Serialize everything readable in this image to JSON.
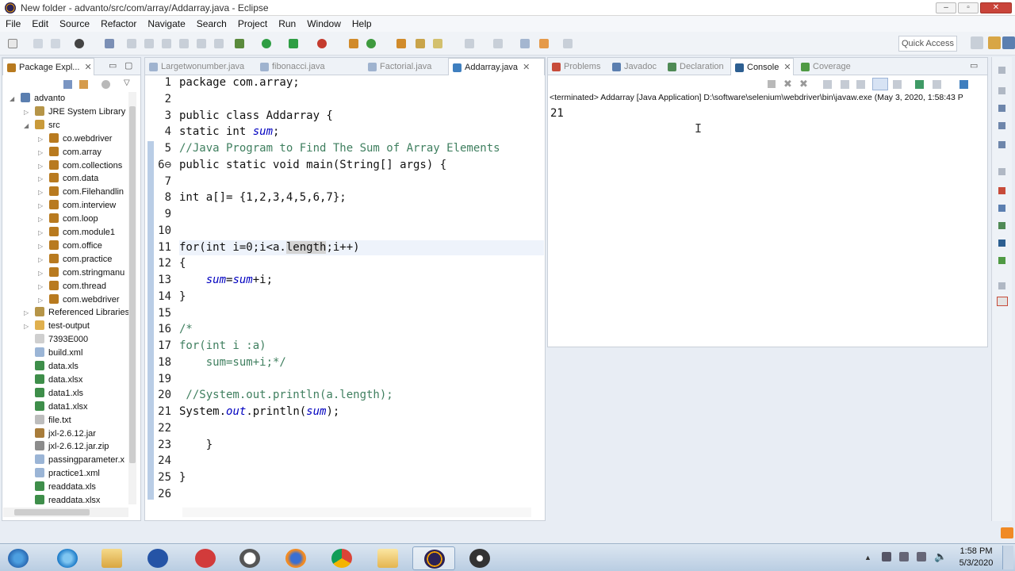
{
  "window": {
    "title": "New folder - advanto/src/com/array/Addarray.java - Eclipse"
  },
  "menu": [
    "File",
    "Edit",
    "Source",
    "Refactor",
    "Navigate",
    "Search",
    "Project",
    "Run",
    "Window",
    "Help"
  ],
  "quick_access": "Quick Access",
  "package_explorer": {
    "tab_label": "Package Expl...",
    "tree": [
      {
        "label": "advanto",
        "indent": 0,
        "icon": "project-icon",
        "expanded": true
      },
      {
        "label": "JRE System Library [",
        "indent": 1,
        "icon": "library-icon"
      },
      {
        "label": "src",
        "indent": 1,
        "icon": "source-folder-icon",
        "expanded": true
      },
      {
        "label": "co.webdriver",
        "indent": 2,
        "icon": "package-icon"
      },
      {
        "label": "com.array",
        "indent": 2,
        "icon": "package-icon"
      },
      {
        "label": "com.collections",
        "indent": 2,
        "icon": "package-icon"
      },
      {
        "label": "com.data",
        "indent": 2,
        "icon": "package-icon"
      },
      {
        "label": "com.Filehandlin",
        "indent": 2,
        "icon": "package-icon"
      },
      {
        "label": "com.interview",
        "indent": 2,
        "icon": "package-icon"
      },
      {
        "label": "com.loop",
        "indent": 2,
        "icon": "package-icon"
      },
      {
        "label": "com.module1",
        "indent": 2,
        "icon": "package-icon"
      },
      {
        "label": "com.office",
        "indent": 2,
        "icon": "package-icon"
      },
      {
        "label": "com.practice",
        "indent": 2,
        "icon": "package-icon"
      },
      {
        "label": "com.stringmanu",
        "indent": 2,
        "icon": "package-icon"
      },
      {
        "label": "com.thread",
        "indent": 2,
        "icon": "package-icon"
      },
      {
        "label": "com.webdriver",
        "indent": 2,
        "icon": "package-icon"
      },
      {
        "label": "Referenced Libraries",
        "indent": 1,
        "icon": "library-icon"
      },
      {
        "label": "test-output",
        "indent": 1,
        "icon": "folder-icon"
      },
      {
        "label": "7393E000",
        "indent": 1,
        "icon": "file-icon"
      },
      {
        "label": "build.xml",
        "indent": 1,
        "icon": "xml-file-icon"
      },
      {
        "label": "data.xls",
        "indent": 1,
        "icon": "excel-file-icon"
      },
      {
        "label": "data.xlsx",
        "indent": 1,
        "icon": "excel-file-icon"
      },
      {
        "label": "data1.xls",
        "indent": 1,
        "icon": "excel-file-icon"
      },
      {
        "label": "data1.xlsx",
        "indent": 1,
        "icon": "excel-file-icon"
      },
      {
        "label": "file.txt",
        "indent": 1,
        "icon": "text-file-icon"
      },
      {
        "label": "jxl-2.6.12.jar",
        "indent": 1,
        "icon": "jar-file-icon"
      },
      {
        "label": "jxl-2.6.12.jar.zip",
        "indent": 1,
        "icon": "zip-file-icon"
      },
      {
        "label": "passingparameter.x",
        "indent": 1,
        "icon": "xml-file-icon"
      },
      {
        "label": "practice1.xml",
        "indent": 1,
        "icon": "xml-file-icon"
      },
      {
        "label": "readdata.xls",
        "indent": 1,
        "icon": "excel-file-icon"
      },
      {
        "label": "readdata.xlsx",
        "indent": 1,
        "icon": "excel-file-icon"
      }
    ]
  },
  "editor": {
    "tabs": [
      {
        "label": "Largetwonumber.java",
        "active": false
      },
      {
        "label": "fibonacci.java",
        "active": false
      },
      {
        "label": "Factorial.java",
        "active": false
      },
      {
        "label": "Addarray.java",
        "active": true
      }
    ],
    "lines": [
      {
        "n": "1",
        "t": "package com.array;"
      },
      {
        "n": "2",
        "t": ""
      },
      {
        "n": "3",
        "t": "public class Addarray {"
      },
      {
        "n": "4",
        "t": "static int sum;"
      },
      {
        "n": "5",
        "t": "//Java Program to Find The Sum of Array Elements"
      },
      {
        "n": "6⊖",
        "t": "public static void main(String[] args) {"
      },
      {
        "n": "7",
        "t": ""
      },
      {
        "n": "8",
        "t": "int a[]= {1,2,3,4,5,6,7};"
      },
      {
        "n": "9",
        "t": ""
      },
      {
        "n": "10",
        "t": ""
      },
      {
        "n": "11",
        "t": "for(int i=0;i<a.length;i++)"
      },
      {
        "n": "12",
        "t": "{"
      },
      {
        "n": "13",
        "t": "    sum=sum+i;"
      },
      {
        "n": "14",
        "t": "}"
      },
      {
        "n": "15",
        "t": ""
      },
      {
        "n": "16",
        "t": "/*"
      },
      {
        "n": "17",
        "t": "for(int i :a)"
      },
      {
        "n": "18",
        "t": "    sum=sum+i;*/"
      },
      {
        "n": "19",
        "t": ""
      },
      {
        "n": "20",
        "t": " //System.out.println(a.length);"
      },
      {
        "n": "21",
        "t": "System.out.println(sum);"
      },
      {
        "n": "22",
        "t": ""
      },
      {
        "n": "23",
        "t": "    }"
      },
      {
        "n": "24",
        "t": ""
      },
      {
        "n": "25",
        "t": "}"
      },
      {
        "n": "26",
        "t": ""
      }
    ]
  },
  "bottom_panel": {
    "tabs": [
      {
        "label": "Problems",
        "active": false
      },
      {
        "label": "Javadoc",
        "active": false
      },
      {
        "label": "Declaration",
        "active": false
      },
      {
        "label": "Console",
        "active": true
      },
      {
        "label": "Coverage",
        "active": false
      }
    ],
    "console_header": "<terminated> Addarray [Java Application] D:\\software\\selenium\\webdriver\\bin\\javaw.exe (May 3, 2020, 1:58:43 P",
    "console_output": "21"
  },
  "taskbar": {
    "time": "1:58 PM",
    "date": "5/3/2020"
  },
  "colors": {
    "accent": "#2c5f9e",
    "package": "#b87a1f",
    "java": "#3f7fbf",
    "comment": "#3f7f5f"
  }
}
